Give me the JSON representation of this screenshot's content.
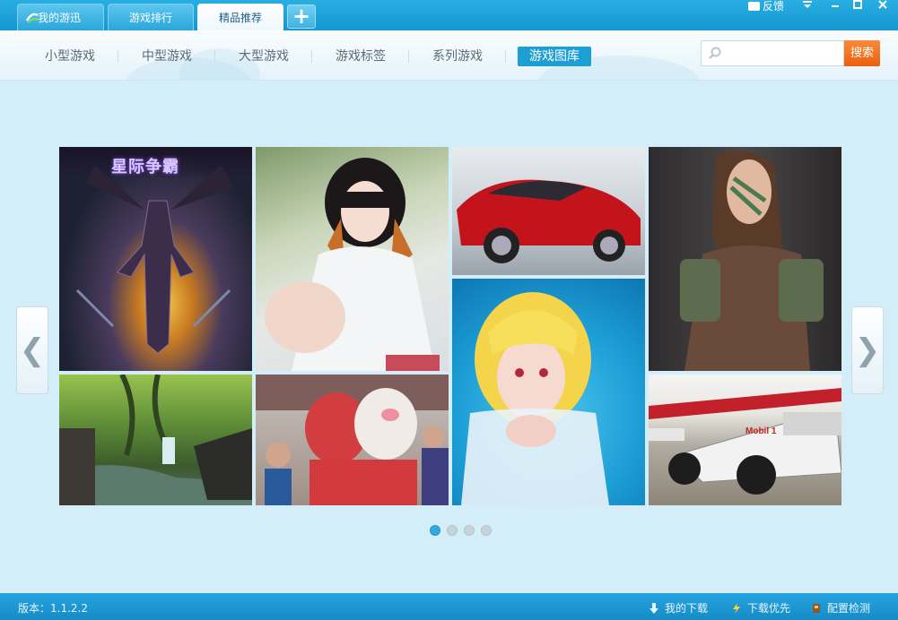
{
  "tabs": [
    {
      "label": "我的游迅"
    },
    {
      "label": "游戏排行"
    },
    {
      "label": "精品推荐"
    }
  ],
  "add_tab": "+",
  "feedback": "反馈",
  "window_controls": {
    "menu": "≡",
    "minimize": "–",
    "maximize": "□",
    "close": "×"
  },
  "nav": [
    "小型游戏",
    "中型游戏",
    "大型游戏",
    "游戏标签",
    "系列游戏",
    "游戏图库"
  ],
  "nav_active": "游戏图库",
  "search": {
    "placeholder": "",
    "value": "",
    "button": "搜索"
  },
  "gallery": {
    "tiles": [
      {
        "caption": "星际争霸"
      },
      {
        "caption": ""
      },
      {
        "caption": ""
      },
      {
        "caption": ""
      },
      {
        "caption": ""
      },
      {
        "caption": ""
      },
      {
        "caption": ""
      },
      {
        "caption": "Mobil 1"
      }
    ],
    "prev": "❮",
    "next": "❯",
    "pages": 4,
    "current_page": 1
  },
  "status": {
    "version": "版本：1.1.2.2",
    "downloads": "我的下载",
    "priority": "下载优先",
    "config": "配置检测"
  },
  "colors": {
    "accent": "#1e9fd4",
    "search_button": "#ea5f12",
    "titlebar": "#1796cf"
  }
}
